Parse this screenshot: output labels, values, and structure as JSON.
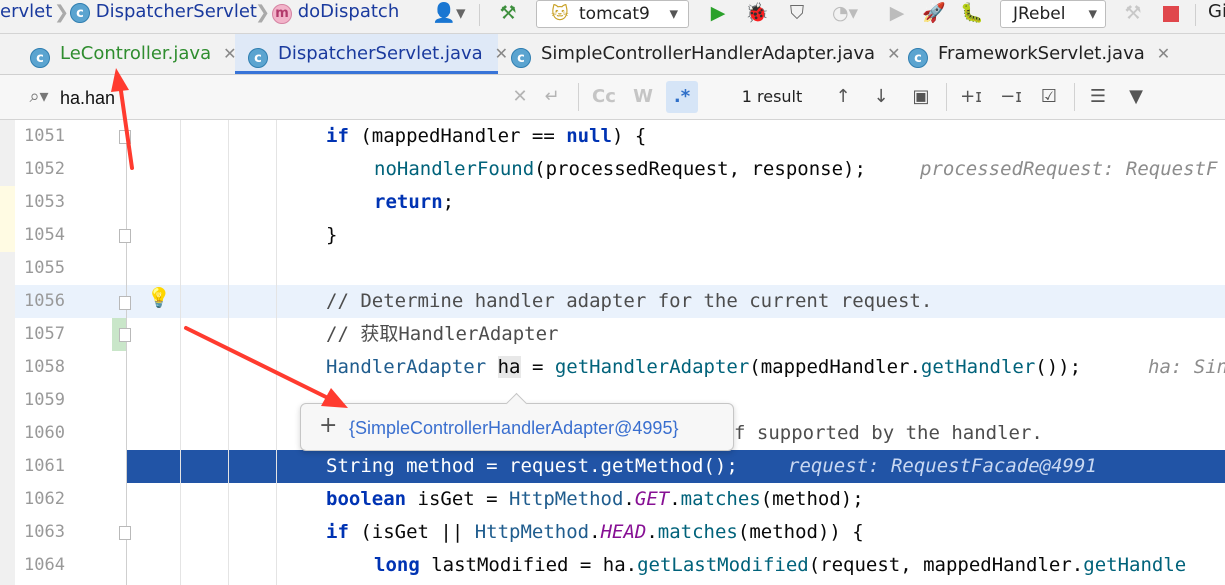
{
  "toolbar": {
    "breadcrumbs": [
      "ervlet",
      "DispatcherServlet",
      "doDispatch"
    ],
    "run_config": "tomcat9",
    "jrebel": "JRebel",
    "cut_label": "Gi"
  },
  "tabs": [
    {
      "label": "LeController.java",
      "active": false,
      "color": "#2f8d2f"
    },
    {
      "label": "DispatcherServlet.java",
      "active": true,
      "color": "#1a3a9e"
    },
    {
      "label": "SimpleControllerHandlerAdapter.java",
      "active": false,
      "color": "#222222"
    },
    {
      "label": "FrameworkServlet.java",
      "active": false,
      "color": "#222222"
    }
  ],
  "search": {
    "query": "ha.han",
    "result": "1 result",
    "case_label": "Cc",
    "word_label": "W",
    "regex_label": ".*"
  },
  "editor": {
    "lines": [
      {
        "num": "1051"
      },
      {
        "num": "1052",
        "hint": "processedRequest: RequestF"
      },
      {
        "num": "1053"
      },
      {
        "num": "1054"
      },
      {
        "num": "1055"
      },
      {
        "num": "1056",
        "comment": "// Determine handler adapter for the current request."
      },
      {
        "num": "1057",
        "comment": "// 获取HandlerAdapter"
      },
      {
        "num": "1058",
        "hint": "ha: Sin"
      },
      {
        "num": "1059"
      },
      {
        "num": "1060",
        "partial": "f supported by the handler."
      },
      {
        "num": "1061",
        "hint": "request: RequestFacade@4991"
      },
      {
        "num": "1062"
      },
      {
        "num": "1063"
      },
      {
        "num": "1064"
      }
    ],
    "tooltip": "{SimpleControllerHandlerAdapter@4995}"
  },
  "colors": {
    "active_tab_bg": "#dfe9f7",
    "current_line": "#eaf2fc",
    "execution_line": "#2154a6",
    "arrow": "#ff3b2f"
  }
}
